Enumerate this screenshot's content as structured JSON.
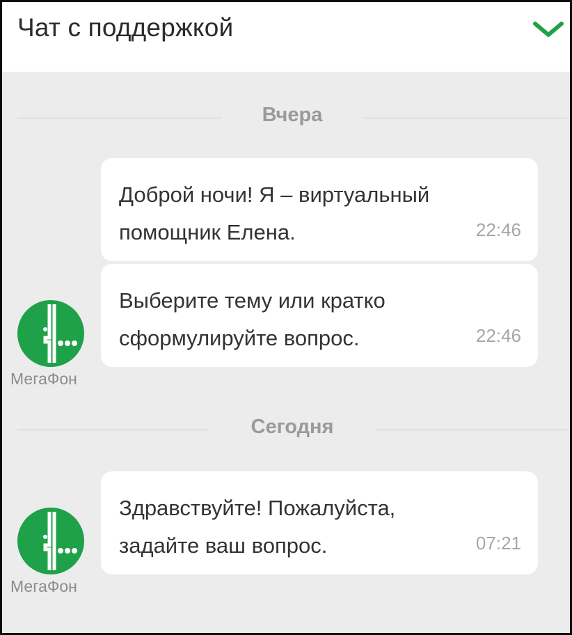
{
  "header": {
    "title": "Чат с поддержкой",
    "collapse_icon": "chevron-down-icon",
    "accent_color": "#1fa14a"
  },
  "chat": {
    "sections": [
      {
        "date_label": "Вчера",
        "sender": "МегаФон",
        "messages": [
          {
            "text_lines": [
              "Доброй ночи! Я – виртуальный",
              "помощник Елена."
            ],
            "time": "22:46"
          },
          {
            "text_lines": [
              "Выберите тему или кратко",
              "сформулируйте вопрос."
            ],
            "time": "22:46"
          }
        ]
      },
      {
        "date_label": "Сегодня",
        "sender": "МегаФон",
        "messages": [
          {
            "text_lines": [
              "Здравствуйте! Пожалуйста,",
              "задайте ваш вопрос."
            ],
            "time": "07:21"
          }
        ]
      }
    ]
  },
  "colors": {
    "background": "#ececec",
    "bubble": "#ffffff",
    "megafon_green": "#1fa14a"
  }
}
